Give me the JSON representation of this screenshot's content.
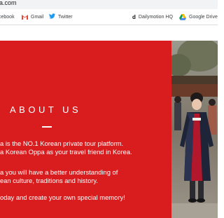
{
  "browser": {
    "url": "a.com",
    "bookmarks": [
      {
        "label": "cebook",
        "icon": "facebook-icon"
      },
      {
        "label": "Gmail",
        "icon": "gmail-icon"
      },
      {
        "label": "Twitter",
        "icon": "twitter-icon"
      },
      {
        "label": "Dailymotion HQ",
        "icon": "dailymotion-icon"
      },
      {
        "label": "Google Drive",
        "icon": "google-drive-icon"
      }
    ]
  },
  "about": {
    "heading": "ABOUT US",
    "paragraphs": [
      [
        "a is the NO.1 Korean private tour platform.",
        "a Korean Oppa as your travel friend in Korea."
      ],
      [
        "a you will have a better understanding of",
        "ean culture, traditions and history."
      ],
      [
        "oday and create your own special memory!"
      ]
    ]
  },
  "colors": {
    "accent": "#d91d1f",
    "bookmark_bar": "#ffffff",
    "url_bar": "#f1f3f4"
  },
  "photo": {
    "description_icon": "hanbok-man-photo"
  }
}
